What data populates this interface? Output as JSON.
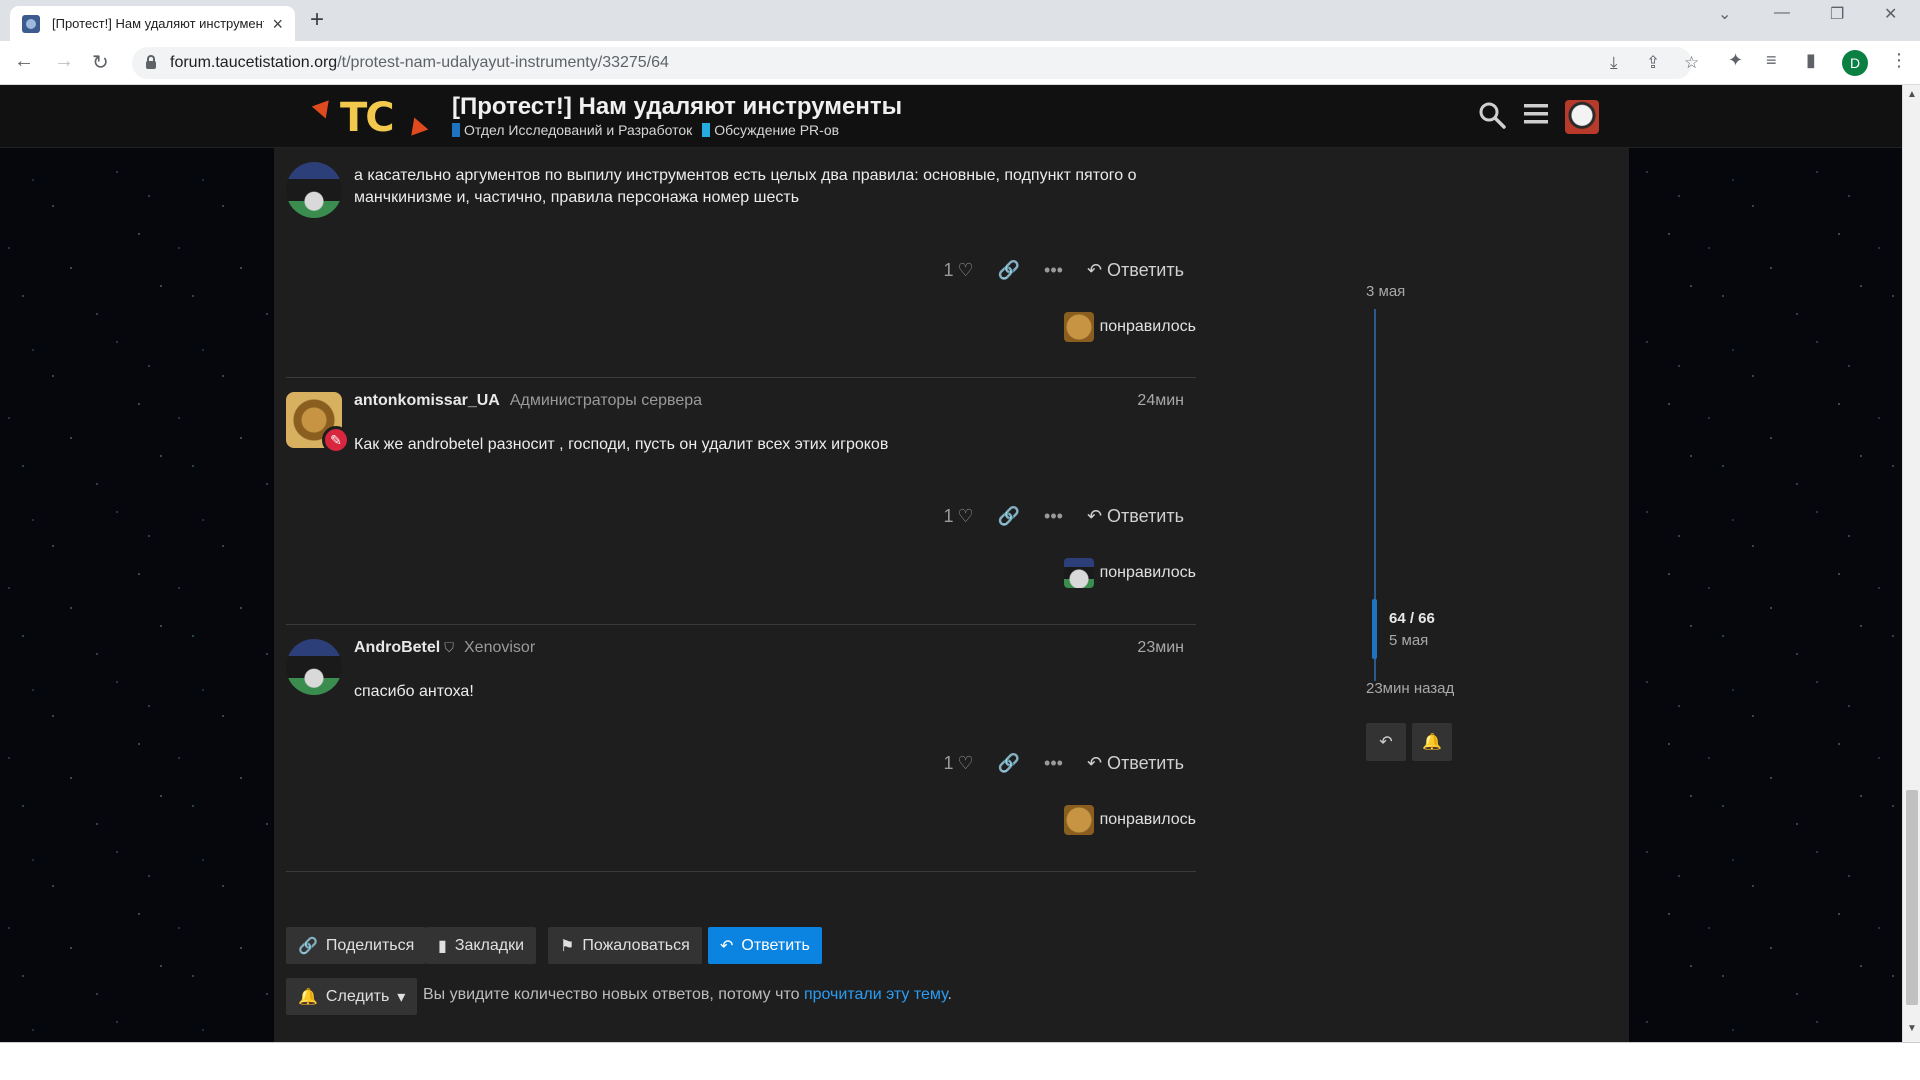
{
  "browser": {
    "tab_title": "[Протест!] Нам удаляют инструменты",
    "url_host": "forum.taucetistation.org",
    "url_path": "/t/protest-nam-udalyayut-instrumenty/33275/64",
    "profile_initial": "D"
  },
  "header": {
    "logo_text": "TC",
    "title": "[Протест!] Нам удаляют инструменты",
    "categories": [
      {
        "label": "Отдел Исследований и Разработок",
        "color": "#1f74c2"
      },
      {
        "label": "Обсуждение PR-ов",
        "color": "#25aae1"
      }
    ]
  },
  "posts": [
    {
      "username": "",
      "user_title": "",
      "date": "",
      "text": "а касательно аргументов по выпилу инструментов есть целых два правила: основные, подпункт пятого о манчкинизме и, частично, правила персонажа номер шесть",
      "likes": "1",
      "reply_label": "Ответить",
      "liked_label": "понравилось"
    },
    {
      "username": "antonkomissar_UA",
      "user_title": "Администраторы сервера",
      "date": "24мин",
      "text": "Как же androbetel разносит , господи, пусть он удалит всех этих игроков",
      "likes": "1",
      "reply_label": "Ответить",
      "liked_label": "понравилось"
    },
    {
      "username": "AndroBetel",
      "user_title": "Xenovisor",
      "date": "23мин",
      "text": "спасибо антоха!",
      "likes": "1",
      "reply_label": "Ответить",
      "liked_label": "понравилось"
    }
  ],
  "timeline": {
    "top_date": "3 мая",
    "position": "64 / 66",
    "position_date": "5 мая",
    "ago": "23мин назад"
  },
  "footer": {
    "share": "Поделиться",
    "bookmarks": "Закладки",
    "flag": "Пожаловаться",
    "reply": "Ответить",
    "notify": "Следить",
    "notify_text": "Вы увидите количество новых ответов, потому что ",
    "notify_link": "прочитали эту тему",
    "notify_end": "."
  }
}
